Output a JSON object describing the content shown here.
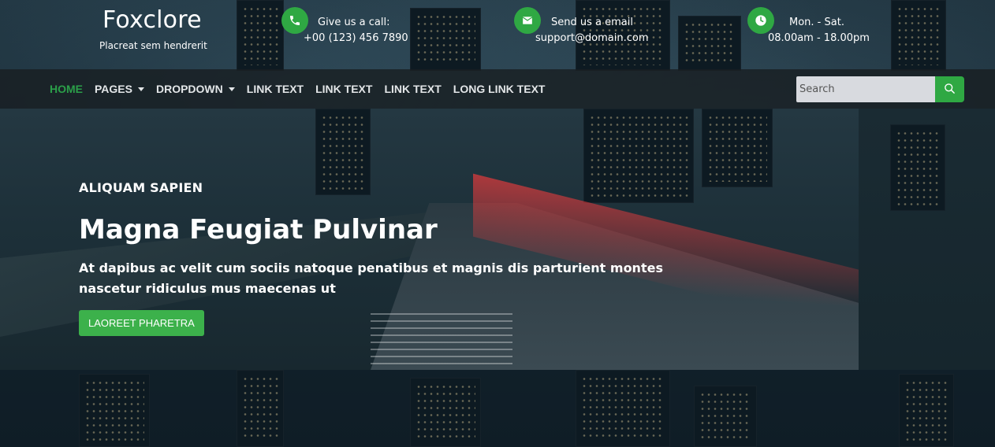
{
  "brand": {
    "name": "Foxclore",
    "tagline": "Placreat sem hendrerit"
  },
  "contacts": [
    {
      "icon": "phone-icon",
      "label": "Give us a call:",
      "value": "+00 (123) 456 7890"
    },
    {
      "icon": "mail-icon",
      "label": "Send us a email",
      "value": "support@domain.com"
    },
    {
      "icon": "clock-icon",
      "label": "Mon. - Sat.",
      "value": "08.00am - 18.00pm"
    }
  ],
  "nav": {
    "items": [
      {
        "label": "HOME",
        "active": true
      },
      {
        "label": "PAGES",
        "dropdown": true
      },
      {
        "label": "DROPDOWN",
        "dropdown": true
      },
      {
        "label": "LINK TEXT"
      },
      {
        "label": "LINK TEXT"
      },
      {
        "label": "LINK TEXT"
      },
      {
        "label": "LONG LINK TEXT"
      }
    ],
    "search_placeholder": "Search"
  },
  "hero": {
    "eyebrow": "ALIQUAM SAPIEN",
    "title": "Magna Feugiat Pulvinar",
    "text": "At dapibus ac velit cum sociis natoque penatibus et magnis dis parturient montes nascetur ridiculus mus maecenas ut",
    "button": "LAOREET PHARETRA"
  },
  "colors": {
    "accent": "#2fa843",
    "active_nav": "#2b9f49"
  }
}
